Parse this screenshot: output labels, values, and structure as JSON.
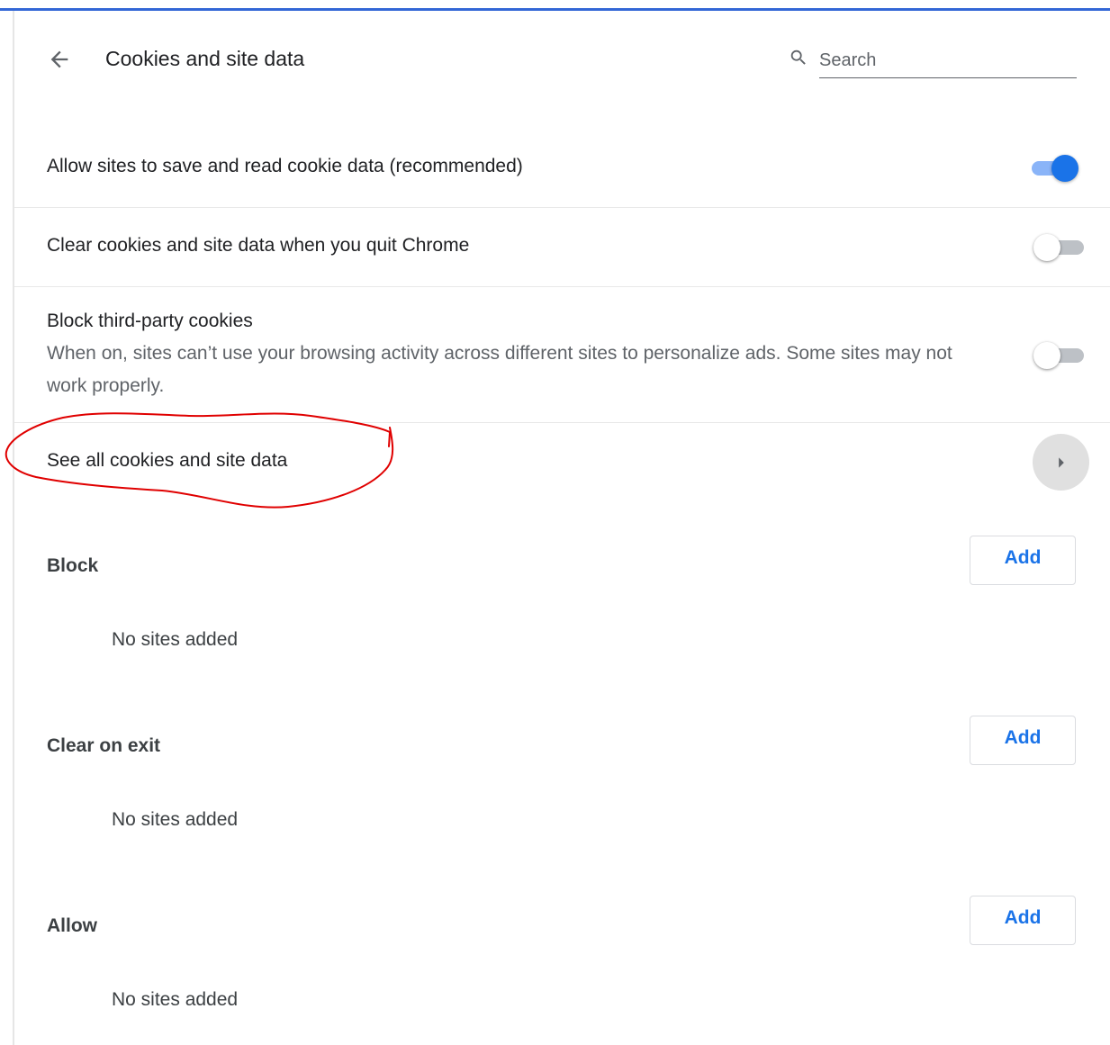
{
  "header": {
    "title": "Cookies and site data",
    "back_icon": "arrow-back-icon",
    "search": {
      "icon": "search-icon",
      "placeholder": "Search",
      "value": ""
    }
  },
  "settings": [
    {
      "label": "Allow sites to save and read cookie data (recommended)",
      "enabled": true
    },
    {
      "label": "Clear cookies and site data when you quit Chrome",
      "enabled": false
    },
    {
      "label": "Block third-party cookies",
      "description": "When on, sites can’t use your browsing activity across different sites to personalize ads. Some sites may not work properly.",
      "enabled": false
    }
  ],
  "see_all": {
    "label": "See all cookies and site data",
    "icon": "arrow-right-icon"
  },
  "sections": [
    {
      "title": "Block",
      "button_label": "Add",
      "empty_text": "No sites added"
    },
    {
      "title": "Clear on exit",
      "button_label": "Add",
      "empty_text": "No sites added"
    },
    {
      "title": "Allow",
      "button_label": "Add",
      "empty_text": "No sites added"
    }
  ],
  "colors": {
    "accent": "#1a73e8",
    "top_bar": "#3367d6",
    "annotation": "#e00000"
  }
}
